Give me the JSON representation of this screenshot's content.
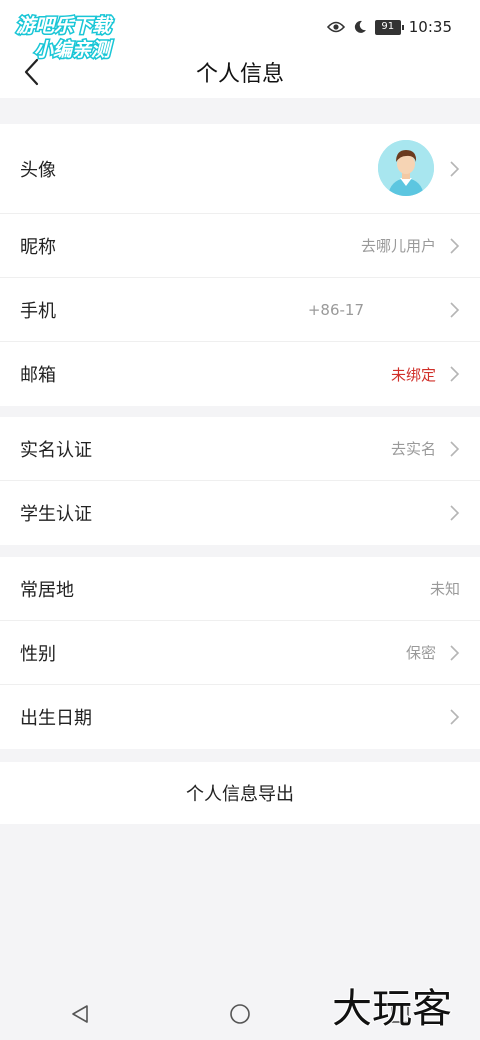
{
  "status_bar": {
    "time": "10:35",
    "battery": "91"
  },
  "watermark_top": {
    "line1": "游吧乐下载",
    "line2": "小编亲测"
  },
  "watermark_bottom": "大玩客",
  "header": {
    "title": "个人信息"
  },
  "group1": {
    "avatar_label": "头像",
    "nickname_label": "昵称",
    "nickname_value": "去哪儿用户",
    "phone_label": "手机",
    "phone_value": "+86-17",
    "email_label": "邮箱",
    "email_value": "未绑定"
  },
  "group2": {
    "realname_label": "实名认证",
    "realname_value": "去实名",
    "student_label": "学生认证"
  },
  "group3": {
    "residence_label": "常居地",
    "residence_value": "未知",
    "gender_label": "性别",
    "gender_value": "保密",
    "birthday_label": "出生日期"
  },
  "export": {
    "label": "个人信息导出"
  },
  "colors": {
    "accent_warning": "#d0302a",
    "secondary_text": "#9a9a9a",
    "background": "#f4f4f6"
  },
  "icons": [
    "back-arrow-icon",
    "eye-icon",
    "moon-icon",
    "battery-icon",
    "chevron-right-icon",
    "nav-back-icon",
    "nav-home-icon",
    "nav-recents-icon"
  ]
}
